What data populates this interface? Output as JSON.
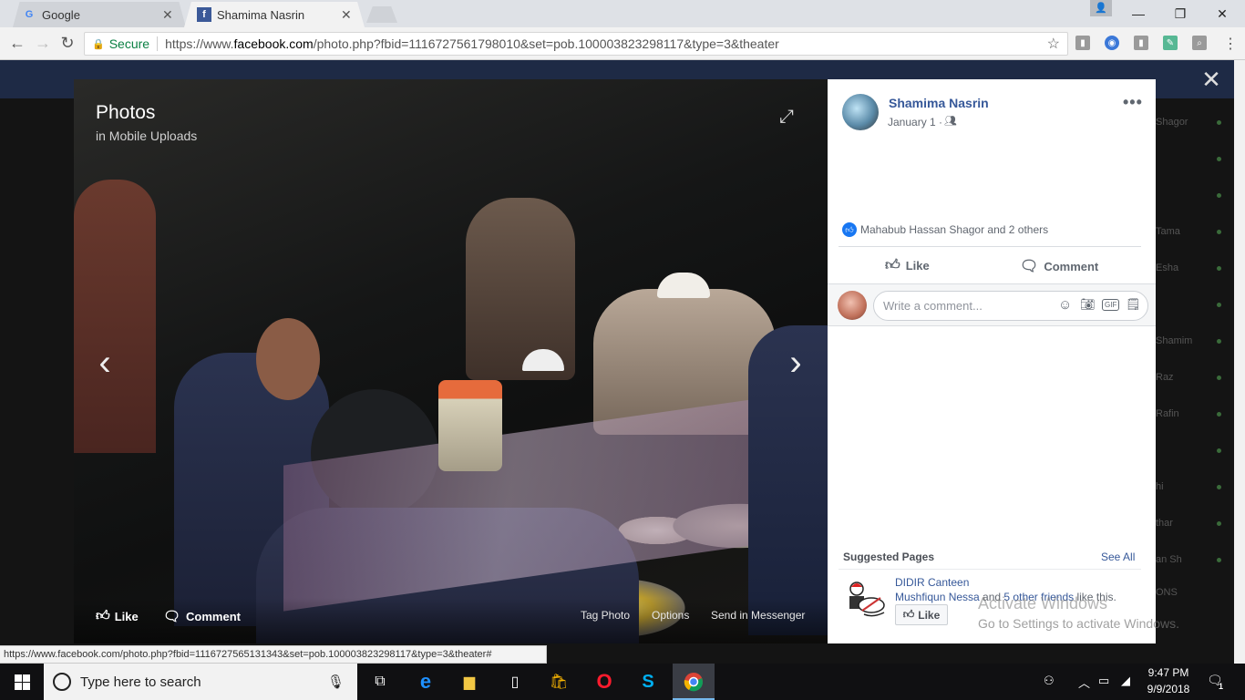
{
  "browser": {
    "tabs": [
      {
        "title": "Google",
        "favicon": "G"
      },
      {
        "title": "Shamima Nasrin",
        "favicon": "f"
      }
    ],
    "secure_label": "Secure",
    "url_prefix": "https://www.",
    "url_host": "facebook.com",
    "url_path": "/photo.php?fbid=1116727561798010&set=pob.100003823298117&type=3&theater",
    "status_url": "https://www.facebook.com/photo.php?fbid=1116727565131343&set=pob.100003823298117&type=3&theater#"
  },
  "photo_viewer": {
    "title": "Photos",
    "subtitle": "in Mobile Uploads",
    "like_label": "Like",
    "comment_label": "Comment",
    "tag_label": "Tag Photo",
    "options_label": "Options",
    "messenger_label": "Send in Messenger"
  },
  "post": {
    "owner_name": "Shamima Nasrin",
    "date": "January 1 ·",
    "likes_text": "Mahabub Hassan Shagor and 2 others",
    "like_label": "Like",
    "comment_label": "Comment",
    "comment_placeholder": "Write a comment...",
    "gif_label": "GIF"
  },
  "suggested": {
    "title": "Suggested Pages",
    "see_all": "See All",
    "page_name": "DIDIR Canteen",
    "friend_name": "Mushfiqun Nessa",
    "friends_middle": " and ",
    "friends_count": "5 other friends",
    "friends_suffix": " like this.",
    "like_label": "Like"
  },
  "right_sidebar": {
    "items": [
      "Shagor",
      "Tama",
      "Esha",
      "Shamim",
      "Raz",
      "Rafin",
      "hi",
      "thar",
      "an Sh",
      "ONS"
    ]
  },
  "watermark": {
    "line1": "Activate Windows",
    "line2": "Go to Settings to activate Windows."
  },
  "taskbar": {
    "search_placeholder": "Type here to search",
    "time": "9:47 PM",
    "date": "9/9/2018",
    "notification_count": "1"
  },
  "colors": {
    "facebook_blue": "#365899",
    "like_blue": "#1877f2",
    "secure_green": "#0b8043"
  }
}
